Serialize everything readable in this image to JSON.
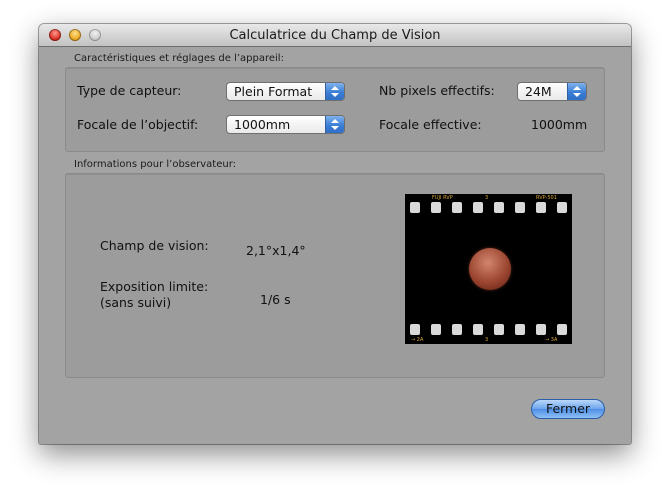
{
  "window": {
    "title": "Calculatrice du Champ de Vision"
  },
  "camera_group": {
    "label": "Caractéristiques et réglages de l’appareil:",
    "sensor_type_label": "Type de capteur:",
    "sensor_type_value": "Plein Format",
    "effective_pixels_label": "Nb pixels effectifs:",
    "effective_pixels_value": "24M",
    "focal_lens_label": "Focale de l’objectif:",
    "focal_lens_value": "1000mm",
    "effective_focal_label": "Focale effective:",
    "effective_focal_value": "1000mm"
  },
  "observer_group": {
    "label": "Informations pour l’observateur:",
    "field_of_view_label": "Champ de vision:",
    "field_of_view_value": "2,1°x1,4°",
    "exposure_label_line1": "Exposition limite:",
    "exposure_label_line2": "(sans suivi)",
    "exposure_value": "1/6 s",
    "film_text": {
      "top_left": "FUJI RVP",
      "top_mid": "3",
      "top_right": "RVP-501",
      "bottom_left": "→ 2A",
      "bottom_mid": "3",
      "bottom_right": "→ 3A"
    }
  },
  "buttons": {
    "close_label": "Fermer"
  },
  "colors": {
    "window_bg": "#a3a3a3",
    "accent_blue": "#3c7fd6",
    "film_text": "#d8a735"
  }
}
